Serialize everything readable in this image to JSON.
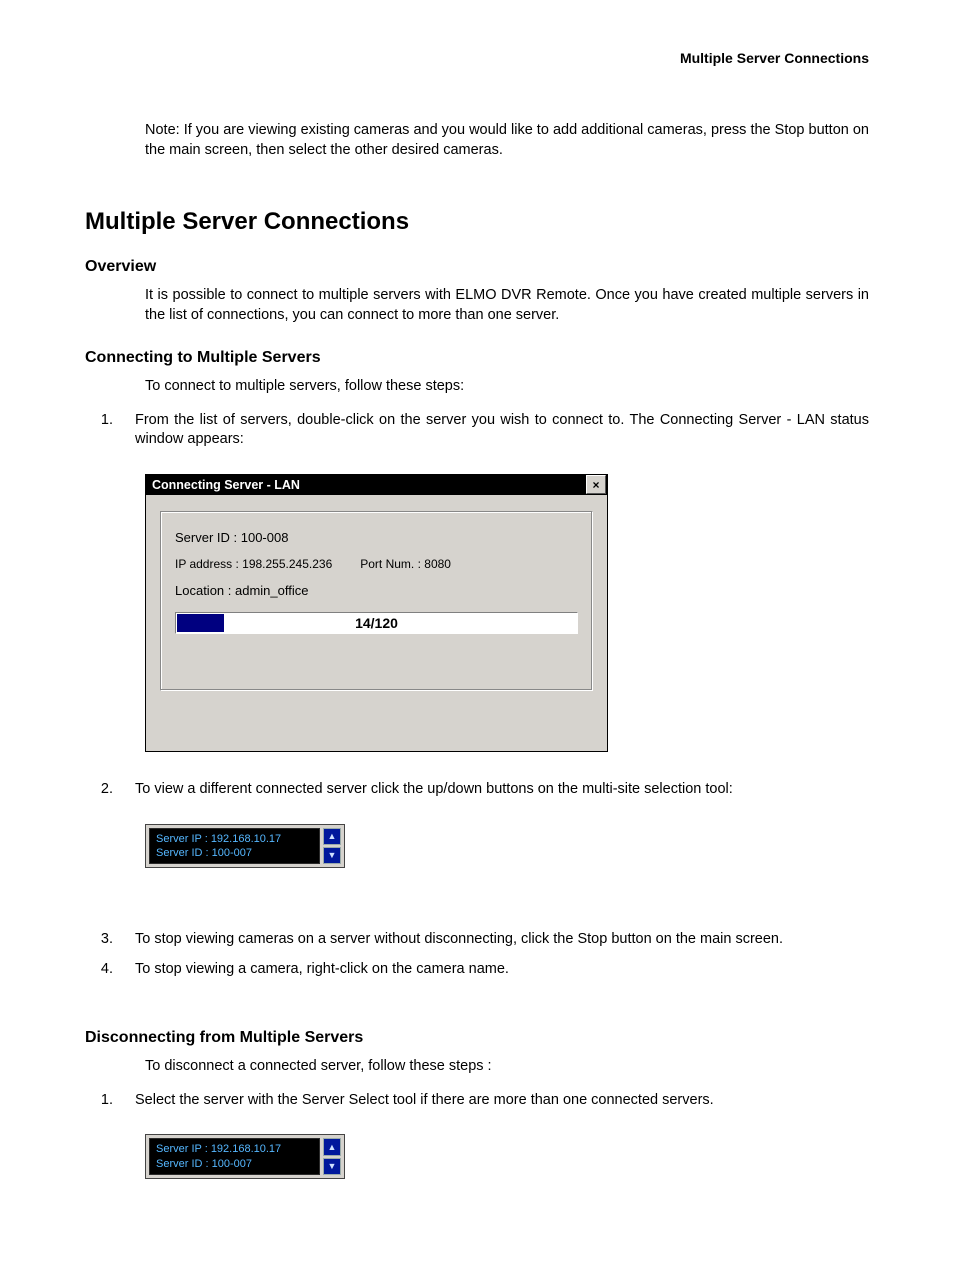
{
  "header": {
    "running": "Multiple Server Connections"
  },
  "note": "Note: If you are viewing existing cameras and you would like to add additional cameras, press the Stop button on the main screen, then select the other desired cameras.",
  "h1": "Multiple Server Connections",
  "overview": {
    "title": "Overview",
    "body": "It is possible to connect to multiple servers with ELMO DVR Remote. Once you have created multiple servers in the list of connections, you can connect to more than one server."
  },
  "connecting": {
    "title": "Connecting to Multiple Servers",
    "intro": "To connect to multiple servers, follow these steps:",
    "step1": "From the list of servers, double-click on the server you wish to connect to. The Connecting Server - LAN status window appears:",
    "step2": "To view a different connected server click the up/down buttons on the multi-site selection tool:",
    "step3": "To stop viewing cameras on a server without disconnecting, click the Stop button on the main screen.",
    "step4": "To stop viewing a camera, right-click on the camera name."
  },
  "dialog": {
    "title": "Connecting Server - LAN",
    "close": "×",
    "server_id": "Server ID : 100-008",
    "ip": "IP address : 198.255.245.236",
    "port": "Port Num. : 8080",
    "location": "Location : admin_office",
    "progress_text": "14/120",
    "progress_pct": 11.7
  },
  "selector": {
    "line1": "Server IP : 192.168.10.17",
    "line2": "Server ID : 100-007",
    "up": "▲",
    "down": "▼"
  },
  "disconnecting": {
    "title": "Disconnecting from Multiple Servers",
    "intro": "To disconnect a connected server, follow these steps :",
    "step1": "Select the server with the Server Select tool if there are more than one connected servers."
  }
}
